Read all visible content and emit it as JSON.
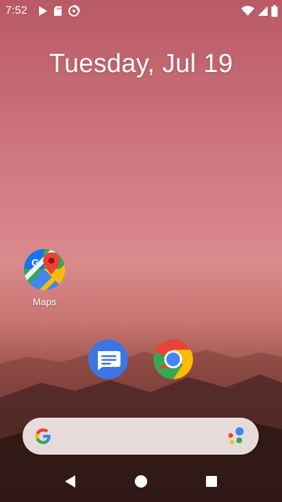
{
  "status_bar": {
    "time": "7:52",
    "notification_icons": [
      "google-play-icon",
      "sd-card-icon",
      "vpn-key-icon"
    ],
    "system_icons": [
      "wifi-icon",
      "cellular-signal-icon",
      "battery-icon"
    ]
  },
  "home": {
    "date": "Tuesday, Jul 19"
  },
  "apps": {
    "maps": {
      "label": "Maps",
      "icon": "google-maps-icon"
    }
  },
  "dock": {
    "items": [
      {
        "icon": "messages-icon"
      },
      {
        "icon": "chrome-icon"
      }
    ]
  },
  "search": {
    "logo": "google-g-icon",
    "assistant_icon": "google-assistant-mic-icon"
  },
  "navigation": {
    "buttons": [
      "back-icon",
      "home-icon",
      "recents-icon"
    ]
  },
  "colors": {
    "wallpaper_top": "#b95a66",
    "wallpaper_mid": "#d98a8d",
    "wallpaper_bottom": "#3a1e1c",
    "search_bar": "#f5ebec",
    "google_blue": "#4285f4",
    "google_red": "#ea4335",
    "google_yellow": "#fbbc05",
    "google_green": "#34a853",
    "messages_blue": "#3d76e3"
  }
}
